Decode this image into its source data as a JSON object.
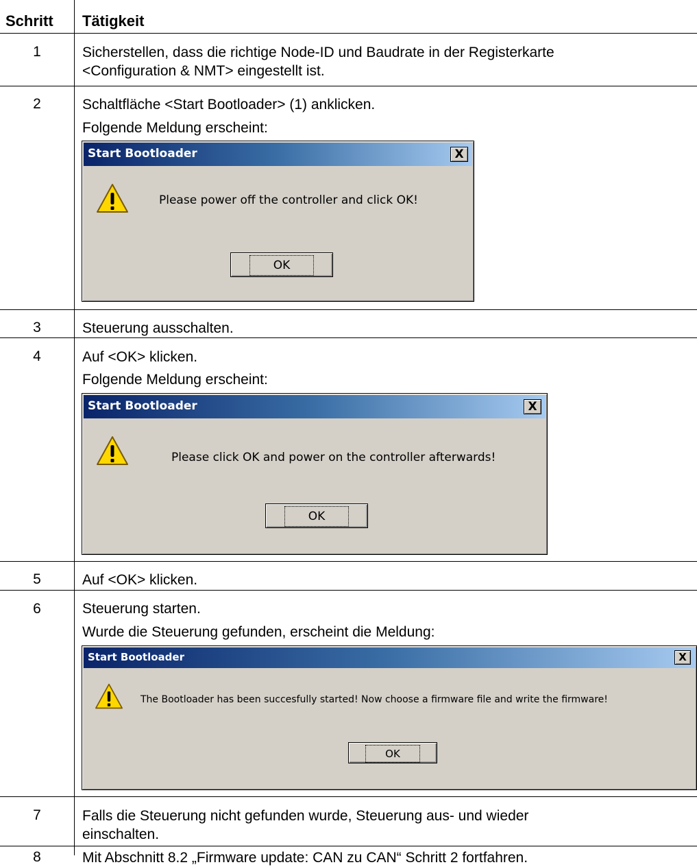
{
  "header": {
    "step": "Schritt",
    "activity": "Tätigkeit"
  },
  "rows": [
    {
      "num": "1",
      "lines": [
        "Sicherstellen, dass die richtige Node-ID und Baudrate in der Registerkarte",
        "<Configuration & NMT> eingestellt ist."
      ]
    },
    {
      "num": "2",
      "lines": [
        "Schaltfläche <Start Bootloader> (1) anklicken.",
        "Folgende Meldung erscheint:"
      ]
    },
    {
      "num": "3",
      "lines": [
        "Steuerung ausschalten."
      ]
    },
    {
      "num": "4",
      "lines": [
        "Auf <OK> klicken.",
        "Folgende Meldung erscheint:"
      ]
    },
    {
      "num": "5",
      "lines": [
        "Auf <OK> klicken."
      ]
    },
    {
      "num": "6",
      "lines": [
        "Steuerung starten.",
        "Wurde die Steuerung gefunden, erscheint die Meldung:"
      ]
    },
    {
      "num": "7",
      "lines": [
        "Falls die Steuerung nicht gefunden wurde, Steuerung aus- und wieder",
        "einschalten."
      ]
    },
    {
      "num": "8",
      "lines": [
        "Mit Abschnitt 8.2 „Firmware update: CAN zu CAN“ Schritt 2 fortfahren."
      ]
    }
  ],
  "dialogs": [
    {
      "title": "Start Bootloader",
      "message": "Please power off the controller and click OK!",
      "ok": "OK",
      "close": "X",
      "icon": "warning-icon"
    },
    {
      "title": "Start Bootloader",
      "message": "Please click OK and power on the controller afterwards!",
      "ok": "OK",
      "close": "X",
      "icon": "warning-icon"
    },
    {
      "title": "Start Bootloader",
      "message": "The Bootloader has been succesfully started! Now choose a firmware file and write the firmware!",
      "ok": "OK",
      "close": "X",
      "icon": "warning-icon"
    }
  ],
  "colors": {
    "dialog_bg": "#d4d0c8",
    "title_start": "#0a246a",
    "title_end": "#a6caf0",
    "warning": "#ffd700"
  }
}
